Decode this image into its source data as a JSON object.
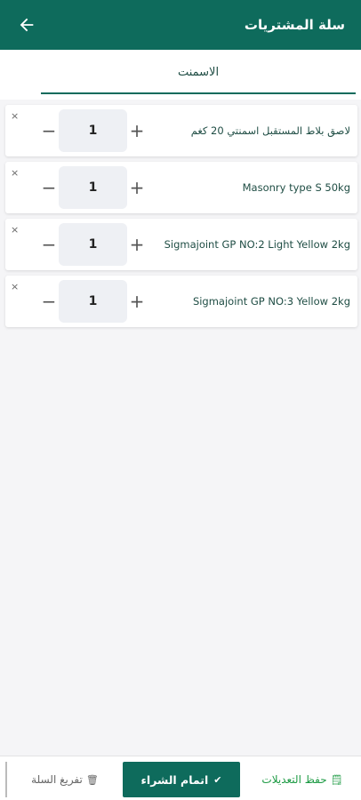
{
  "header": {
    "title": "سلة المشتريات",
    "back_icon": "arrow-left-icon"
  },
  "tabs": [
    {
      "label": "الاسمنت",
      "selected": true
    }
  ],
  "cart": {
    "items": [
      {
        "name": "لاصق بلاط المستقبل اسمنتي 20 كغم",
        "quantity": "1",
        "minus": "−",
        "plus": "+",
        "remove": "×"
      },
      {
        "name": "Masonry type S 50kg",
        "quantity": "1",
        "minus": "−",
        "plus": "+",
        "remove": "×"
      },
      {
        "name": "Sigmajoint GP NO:2 Light Yellow 2kg",
        "quantity": "1",
        "minus": "−",
        "plus": "+",
        "remove": "×"
      },
      {
        "name": "Sigmajoint GP NO:3 Yellow 2kg",
        "quantity": "1",
        "minus": "−",
        "plus": "+",
        "remove": "×"
      }
    ]
  },
  "footer": {
    "clear_label": "تفريغ السلة",
    "clear_icon_glyph": "🗑",
    "checkout_label": "اتمام الشراء",
    "checkout_icon_glyph": "✔",
    "save_label": "حفظ التعديلات",
    "save_icon_glyph": "🗒"
  },
  "colors": {
    "primary": "#0e6b5c",
    "save_green": "#1c9a43",
    "background": "#f5f5f7"
  }
}
